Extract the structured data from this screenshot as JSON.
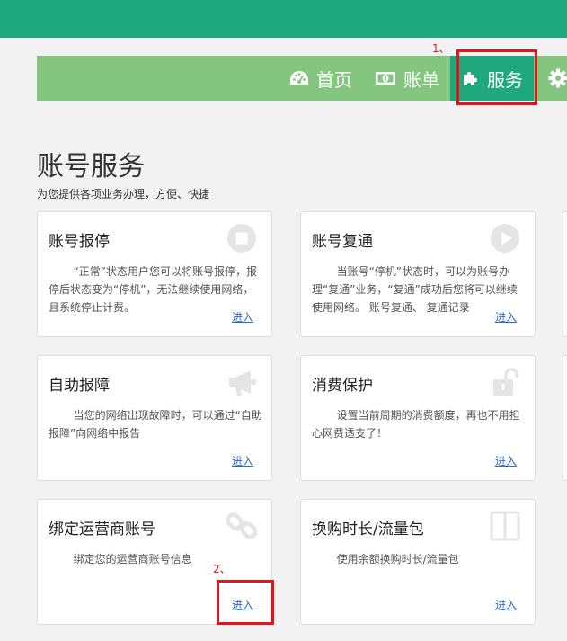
{
  "nav": {
    "items": [
      {
        "label": "首页",
        "icon": "dashboard-icon"
      },
      {
        "label": "账单",
        "icon": "money-icon"
      },
      {
        "label": "服务",
        "icon": "puzzle-icon",
        "active": true
      },
      {
        "label": "",
        "icon": "gear-icon"
      }
    ]
  },
  "annotations": {
    "step1": "1、",
    "step2": "2、"
  },
  "page": {
    "title": "账号服务",
    "subtitle": "为您提供各项业务办理，方便、快捷"
  },
  "cards": [
    {
      "title": "账号报停",
      "icon": "stop-icon",
      "desc": "“正常”状态用户您可以将账号报停，报停后状态变为“停机”，无法继续使用网络，且系统停止计费。",
      "link": "进入"
    },
    {
      "title": "账号复通",
      "icon": "play-icon",
      "desc": "当账号“停机”状态时，可以为账号办理“复通”业务，“复通”成功后您将可以继续使用网络。 账号复通、 复通记录",
      "link": "进入"
    },
    {
      "title": "自助报障",
      "icon": "megaphone-icon",
      "desc": "当您的网络出现故障时，可以通过“自助报障”向网络中报告",
      "link": "进入"
    },
    {
      "title": "消费保护",
      "icon": "unlock-icon",
      "desc": "设置当前周期的消费额度，再也不用担心网费透支了！",
      "link": "进入"
    },
    {
      "title": "绑定运营商账号",
      "icon": "link-icon",
      "desc": "绑定您的运营商账号信息",
      "link": "进入"
    },
    {
      "title": "换购时长/流量包",
      "icon": "columns-icon",
      "desc": "使用余额换购时长/流量包",
      "link": "进入"
    }
  ],
  "colors": {
    "topbar": "#1ea87b",
    "nav": "#84c67f",
    "active": "#1ea87b",
    "highlight": "#e3141d",
    "link": "#2d6ac9"
  }
}
